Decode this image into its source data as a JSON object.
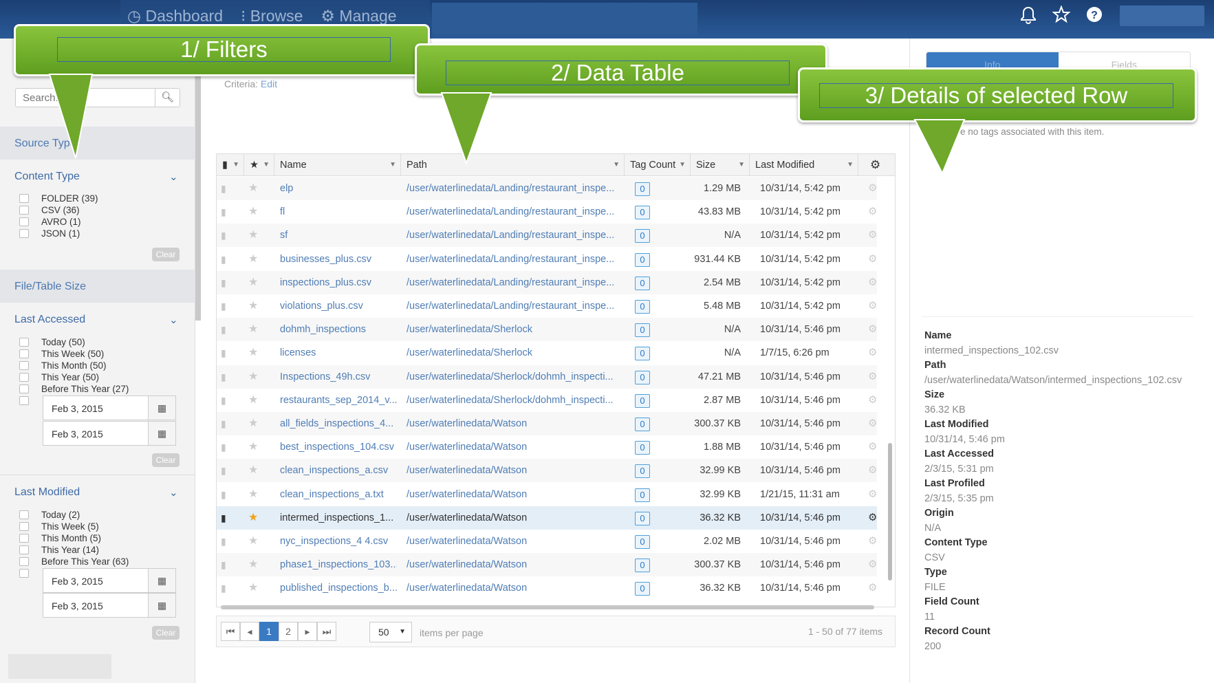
{
  "topnav": {
    "dashboard": "Dashboard",
    "browse": "Browse",
    "manage": "Manage"
  },
  "search": {
    "placeholder": "Search..."
  },
  "filters": {
    "source_type": "Source Type",
    "content_type": {
      "title": "Content Type",
      "items": [
        "FOLDER (39)",
        "CSV (36)",
        "AVRO (1)",
        "JSON (1)"
      ]
    },
    "file_table_size": "File/Table Size",
    "last_accessed": {
      "title": "Last Accessed",
      "items": [
        "Today (50)",
        "This Week (50)",
        "This Month (50)",
        "This Year (50)",
        "Before This Year (27)"
      ],
      "date_from": "Feb 3, 2015",
      "date_to": "Feb 3, 2015"
    },
    "last_modified": {
      "title": "Last Modified",
      "items": [
        "Today (2)",
        "This Week (5)",
        "This Month (5)",
        "This Year (14)",
        "Before This Year (63)"
      ],
      "date_from": "Feb 3, 2015",
      "date_to": "Feb 3, 2015"
    },
    "clear_label": "Clear"
  },
  "criteria": {
    "label": "Criteria:",
    "edit": "Edit"
  },
  "table": {
    "columns": {
      "name": "Name",
      "path": "Path",
      "tag_count": "Tag Count",
      "size": "Size",
      "last_modified": "Last Modified"
    },
    "rows": [
      {
        "name": "elp",
        "path": "/user/waterlinedata/Landing/restaurant_inspe...",
        "tags": "0",
        "size": "1.29 MB",
        "modified": "10/31/14, 5:42 pm"
      },
      {
        "name": "fl",
        "path": "/user/waterlinedata/Landing/restaurant_inspe...",
        "tags": "0",
        "size": "43.83 MB",
        "modified": "10/31/14, 5:42 pm"
      },
      {
        "name": "sf",
        "path": "/user/waterlinedata/Landing/restaurant_inspe...",
        "tags": "0",
        "size": "N/A",
        "modified": "10/31/14, 5:42 pm"
      },
      {
        "name": "businesses_plus.csv",
        "path": "/user/waterlinedata/Landing/restaurant_inspe...",
        "tags": "0",
        "size": "931.44 KB",
        "modified": "10/31/14, 5:42 pm"
      },
      {
        "name": "inspections_plus.csv",
        "path": "/user/waterlinedata/Landing/restaurant_inspe...",
        "tags": "0",
        "size": "2.54 MB",
        "modified": "10/31/14, 5:42 pm"
      },
      {
        "name": "violations_plus.csv",
        "path": "/user/waterlinedata/Landing/restaurant_inspe...",
        "tags": "0",
        "size": "5.48 MB",
        "modified": "10/31/14, 5:42 pm"
      },
      {
        "name": "dohmh_inspections",
        "path": "/user/waterlinedata/Sherlock",
        "tags": "0",
        "size": "N/A",
        "modified": "10/31/14, 5:46 pm"
      },
      {
        "name": "licenses",
        "path": "/user/waterlinedata/Sherlock",
        "tags": "0",
        "size": "N/A",
        "modified": "1/7/15, 6:26 pm"
      },
      {
        "name": "Inspections_49h.csv",
        "path": "/user/waterlinedata/Sherlock/dohmh_inspecti...",
        "tags": "0",
        "size": "47.21 MB",
        "modified": "10/31/14, 5:46 pm"
      },
      {
        "name": "restaurants_sep_2014_v...",
        "path": "/user/waterlinedata/Sherlock/dohmh_inspecti...",
        "tags": "0",
        "size": "2.87 MB",
        "modified": "10/31/14, 5:46 pm"
      },
      {
        "name": "all_fields_inspections_4...",
        "path": "/user/waterlinedata/Watson",
        "tags": "0",
        "size": "300.37 KB",
        "modified": "10/31/14, 5:46 pm"
      },
      {
        "name": "best_inspections_104.csv",
        "path": "/user/waterlinedata/Watson",
        "tags": "0",
        "size": "1.88 MB",
        "modified": "10/31/14, 5:46 pm"
      },
      {
        "name": "clean_inspections_a.csv",
        "path": "/user/waterlinedata/Watson",
        "tags": "0",
        "size": "32.99 KB",
        "modified": "10/31/14, 5:46 pm"
      },
      {
        "name": "clean_inspections_a.txt",
        "path": "/user/waterlinedata/Watson",
        "tags": "0",
        "size": "32.99 KB",
        "modified": "1/21/15, 11:31 am"
      },
      {
        "name": "intermed_inspections_1...",
        "path": "/user/waterlinedata/Watson",
        "tags": "0",
        "size": "36.32 KB",
        "modified": "10/31/14, 5:46 pm",
        "selected": true
      },
      {
        "name": "nyc_inspections_4 4.csv",
        "path": "/user/waterlinedata/Watson",
        "tags": "0",
        "size": "2.02 MB",
        "modified": "10/31/14, 5:46 pm"
      },
      {
        "name": "phase1_inspections_103...",
        "path": "/user/waterlinedata/Watson",
        "tags": "0",
        "size": "300.37 KB",
        "modified": "10/31/14, 5:46 pm"
      },
      {
        "name": "published_inspections_b...",
        "path": "/user/waterlinedata/Watson",
        "tags": "0",
        "size": "36.32 KB",
        "modified": "10/31/14, 5:46 pm"
      }
    ]
  },
  "pager": {
    "page1": "1",
    "page2": "2",
    "per_page": "50",
    "per_page_label": "items per page",
    "count": "1 - 50 of 77 items"
  },
  "detail_tabs": {
    "info": "Info",
    "fields": "Fields"
  },
  "details": {
    "no_tags": "e no tags associated with this item.",
    "items": [
      {
        "k": "Name",
        "v": "intermed_inspections_102.csv"
      },
      {
        "k": "Path",
        "v": "/user/waterlinedata/Watson/intermed_inspections_102.csv"
      },
      {
        "k": "Size",
        "v": "36.32 KB"
      },
      {
        "k": "Last Modified",
        "v": "10/31/14, 5:46 pm"
      },
      {
        "k": "Last Accessed",
        "v": "2/3/15, 5:31 pm"
      },
      {
        "k": "Last Profiled",
        "v": "2/3/15, 5:35 pm"
      },
      {
        "k": "Origin",
        "v": "N/A"
      },
      {
        "k": "Content Type",
        "v": "CSV"
      },
      {
        "k": "Type",
        "v": "FILE"
      },
      {
        "k": "Field Count",
        "v": "11"
      },
      {
        "k": "Record Count",
        "v": "200"
      }
    ]
  },
  "callouts": {
    "filters": "1/ Filters",
    "table": "2/ Data Table",
    "details": "3/ Details of selected Row"
  },
  "colors": {
    "callout_green": "#7ab62f",
    "nav_blue": "#1f4b86",
    "accent": "#3a7ac3"
  }
}
